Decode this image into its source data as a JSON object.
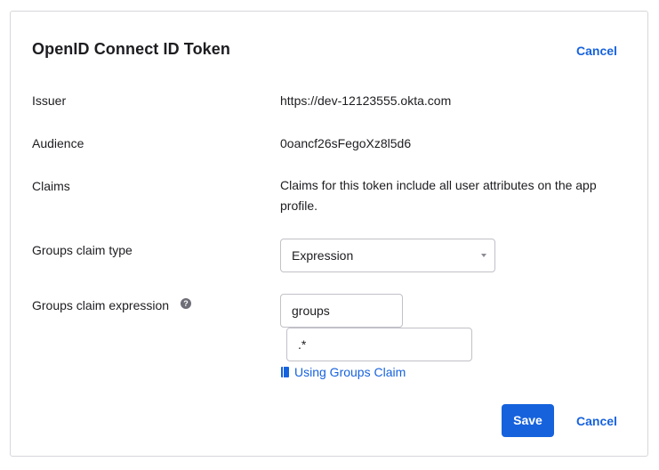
{
  "header": {
    "title": "OpenID Connect ID Token",
    "cancel_label": "Cancel"
  },
  "fields": {
    "issuer": {
      "label": "Issuer",
      "value": "https://dev-12123555.okta.com"
    },
    "audience": {
      "label": "Audience",
      "value": "0oancf26sFegoXz8l5d6"
    },
    "claims": {
      "label": "Claims",
      "value": "Claims for this token include all user attributes on the app profile."
    },
    "groups_claim_type": {
      "label": "Groups claim type",
      "selected": "Expression"
    },
    "groups_claim_expression": {
      "label": "Groups claim expression",
      "help_icon": "question-icon",
      "help_glyph": "?",
      "name_value": "groups",
      "expression_value": ".*"
    }
  },
  "doc_link": {
    "label": "Using Groups Claim",
    "icon": "book-icon"
  },
  "footer": {
    "save_label": "Save",
    "cancel_label": "Cancel"
  },
  "colors": {
    "accent": "#1662dd",
    "text": "#1d1d21",
    "border": "#d7d7dc"
  }
}
